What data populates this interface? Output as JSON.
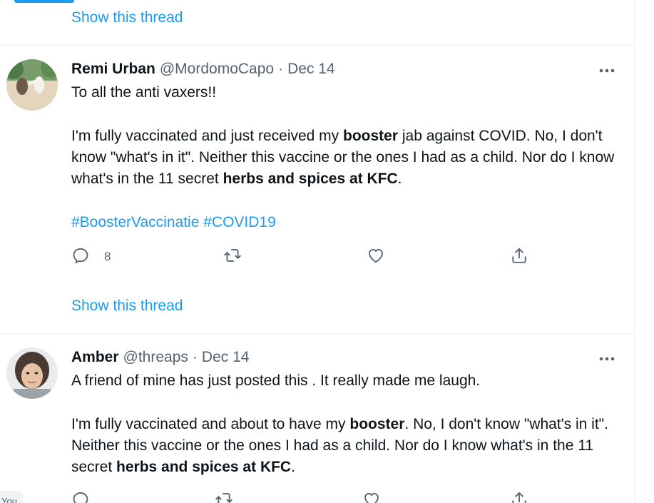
{
  "top": {
    "show_thread": "Show this thread"
  },
  "tweets": [
    {
      "author_name": "Remi Urban",
      "handle": "@MordomoCapo",
      "separator": "·",
      "date": "Dec 14",
      "avatar_icon": "avatar-photo-martial-arts",
      "line1": "To all the anti vaxers!!",
      "p2_a": "I'm fully vaccinated and just received my ",
      "p2_b": "booster",
      "p2_c": " jab against COVID. No, I don't know \"what's in it\". Neither this vaccine or the ones I had as a child. Nor do I know what's in the 11 secret ",
      "p2_d": "herbs and spices at KFC",
      "p2_e": ".",
      "hashtag1": "#BoosterVaccinatie",
      "hashtag2": "#COVID19",
      "reply_count": "8",
      "show_thread": "Show this thread"
    },
    {
      "author_name": "Amber",
      "handle": "@threaps",
      "separator": "·",
      "date": "Dec 14",
      "avatar_icon": "avatar-photo-woman",
      "line1": "A friend of mine has just posted this . It really made me laugh.",
      "p2_a": "I'm fully vaccinated and about to have my ",
      "p2_b": "booster",
      "p2_c": ". No, I don't know \"what's in it\". Neither this vaccine or the ones I had as a child. Nor do I know what's in the 11 secret ",
      "p2_d": "herbs and spices at KFC",
      "p2_e": "."
    }
  ],
  "chip": {
    "label": "You"
  },
  "colors": {
    "accent": "#1d9bf0",
    "text": "#0f1419",
    "muted": "#536471",
    "border": "#eff3f4"
  },
  "icons": {
    "reply": "reply-icon",
    "retweet": "retweet-icon",
    "like": "heart-icon",
    "share": "share-icon",
    "more": "more-options-icon"
  }
}
